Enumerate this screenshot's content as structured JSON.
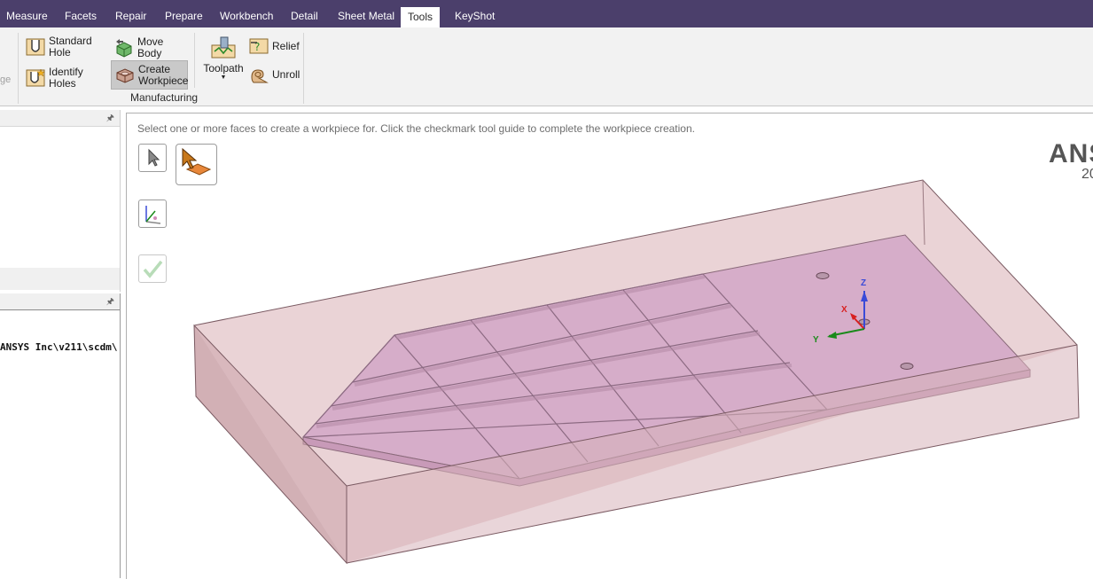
{
  "menu": {
    "tabs": [
      "Measure",
      "Facets",
      "Repair",
      "Prepare",
      "Workbench",
      "Detail",
      "Sheet Metal",
      "Tools",
      "KeyShot"
    ],
    "active": "Tools"
  },
  "ribbon": {
    "faded_text": "ge",
    "standard_hole": "Standard Hole",
    "identify_holes": "Identify Holes",
    "move_body": "Move Body",
    "create_workpiece": "Create Workpiece",
    "toolpath": "Toolpath",
    "relief": "Relief",
    "unroll": "Unroll",
    "group_label": "Manufacturing"
  },
  "left_panel": {
    "path_text": "ANSYS Inc\\v211\\scdm\\"
  },
  "viewport": {
    "hint": "Select one or more faces to create a workpiece for. Click the checkmark tool guide to complete the workpiece creation.",
    "brand": "ANS",
    "brand_sub": "20"
  },
  "triad": {
    "z": "Z",
    "x": "X",
    "y": "Y"
  },
  "colors": {
    "menu_bg": "#4b3f6b",
    "workpiece_fill": "#e8c9cf",
    "part_fill": "#d3a9c9",
    "edge": "#7a5a62"
  },
  "icons": [
    "standard-hole-icon",
    "identify-holes-icon",
    "move-body-icon",
    "create-workpiece-icon",
    "toolpath-icon",
    "relief-icon",
    "unroll-icon",
    "select-arrow-icon",
    "select-face-icon",
    "axis-icon",
    "checkmark-icon",
    "pin-icon"
  ]
}
